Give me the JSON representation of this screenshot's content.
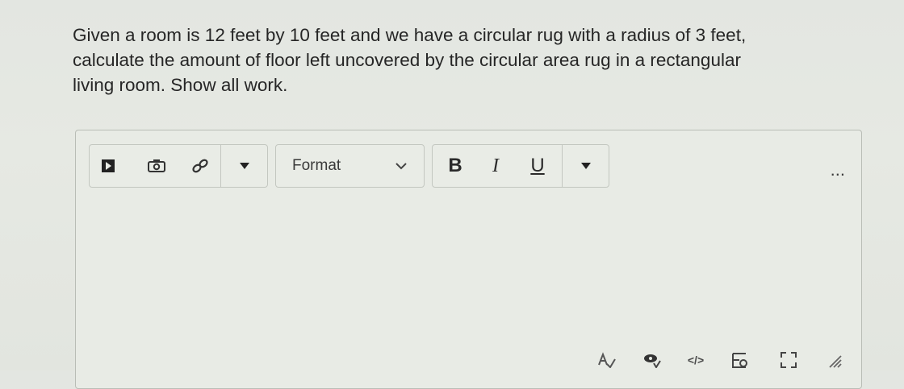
{
  "question": {
    "line1": "Given a room is 12 feet by 10 feet and we have a circular rug with a radius of 3 feet,",
    "line2": "calculate the amount of floor left uncovered by the circular area rug in a rectangular",
    "line3": "living room.  Show all work."
  },
  "toolbar": {
    "format_label": "Format",
    "bold_label": "B",
    "italic_label": "I",
    "underline_label": "U",
    "more_label": "...",
    "icons": [
      "media-icon",
      "image-icon",
      "link-icon",
      "dropdown-arrow-icon",
      "chevron-down-icon",
      "dropdown-arrow-icon"
    ]
  },
  "statusbar": {
    "html_label": "</>",
    "icons": [
      "spellcheck-icon",
      "accessibility-icon",
      "html-editor-icon",
      "equation-icon",
      "fullscreen-icon",
      "resize-handle-icon"
    ]
  }
}
